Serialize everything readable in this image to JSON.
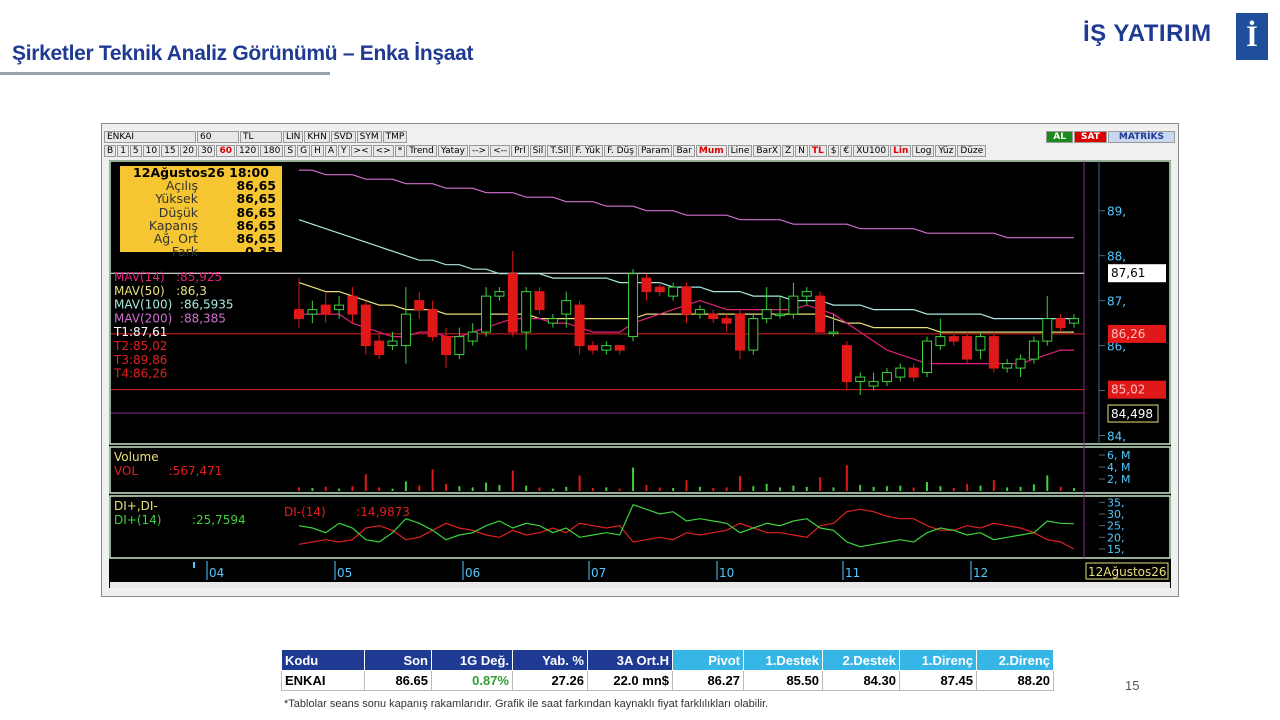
{
  "header": {
    "title": "Şirketler Teknik Analiz Görünümü – Enka İnşaat",
    "logo_text": "İŞ YATIRIM",
    "logo_mark": "İ",
    "page_number": "15"
  },
  "toolbar": {
    "row1": [
      "ENKAI",
      "60",
      "TL",
      "LIN",
      "KHN",
      "SVD",
      "SYM",
      "TMP"
    ],
    "al_label": "AL",
    "sat_label": "SAT",
    "brand": "MATRİKS",
    "row2": [
      "B",
      "1",
      "5",
      "10",
      "15",
      "20",
      "30",
      "60",
      "120",
      "180",
      "S",
      "G",
      "H",
      "A",
      "Y",
      "><",
      "<>",
      "*",
      "Trend",
      "Yatay",
      "-->",
      "<--",
      "Prl",
      "Sil",
      "T.Sil",
      "F. Yük",
      "F. Düş",
      "Param",
      "Bar",
      "Mum",
      "Line",
      "BarX",
      "Z",
      "N",
      "TL",
      "$",
      "€",
      "XU100",
      "Lin",
      "Log",
      "Yüz",
      "Düze"
    ]
  },
  "info_box": {
    "date": "12Ağustos26 18:00",
    "rows": [
      {
        "label": "Açılış",
        "value": "86,65"
      },
      {
        "label": "Yüksek",
        "value": "86,65"
      },
      {
        "label": "Düşük",
        "value": "86,65"
      },
      {
        "label": "Kapanış",
        "value": "86,65"
      },
      {
        "label": "Ağ. Ort",
        "value": "86,65"
      },
      {
        "label": "Fark",
        "value": "0,35"
      }
    ]
  },
  "legend": {
    "mav14": "MAV(14)   :85,925",
    "mav50": "MAV(50)   :86,3",
    "mav100": "MAV(100)  :86,5935",
    "mav200": "MAV(200)  :88,385",
    "t1": "T1:87,61",
    "t2": "T2:85,02",
    "t3": "T3:89,86",
    "t4": "T4:86,26"
  },
  "price_axis": {
    "ticks": [
      "89,",
      "88,",
      "87,",
      "86,",
      "85,",
      "84,"
    ],
    "labels": {
      "t1": "87,61",
      "t4": "86,26",
      "t2": "85,02",
      "low": "84,498"
    }
  },
  "volume_panel": {
    "title": "Volume",
    "vol": "VOL        :567,471",
    "ticks": [
      "6, M",
      "4, M",
      "2, M"
    ]
  },
  "di_panel": {
    "title": "DI+,DI-",
    "di_plus": "DI+(14)        :25,7594",
    "di_minus": "DI-(14)        :14,9873",
    "ticks": [
      "35,",
      "30,",
      "25,",
      "20,",
      "15,"
    ]
  },
  "time_axis": {
    "labels": [
      "04",
      "05",
      "06",
      "07",
      "10",
      "11",
      "12"
    ],
    "current": "12Ağustos26"
  },
  "colors": {
    "up": "#3cd23c",
    "down": "#e01818",
    "mav14": "#e0207a",
    "mav50": "#e8e07a",
    "mav100": "#a8e8e0",
    "mav200": "#d070d0"
  },
  "table": {
    "headers": [
      "Kodu",
      "Son",
      "1G Değ.",
      "Yab. %",
      "3A Ort.H",
      "Pivot",
      "1.Destek",
      "2.Destek",
      "1.Direnç",
      "2.Direnç"
    ],
    "row": [
      "ENKAI",
      "86.65",
      "0.87%",
      "27.26",
      "22.0 mn$",
      "86.27",
      "85.50",
      "84.30",
      "87.45",
      "88.20"
    ]
  },
  "footnote": "*Tablolar seans sonu kapanış rakamlarıdır. Grafik ile saat farkından kaynaklı fiyat farklılıkları olabilir.",
  "chart_data": {
    "type": "candlestick",
    "unit": "TRY",
    "candles": [
      {
        "o": 86.8,
        "c": 86.6,
        "h": 87.5,
        "l": 86.4
      },
      {
        "o": 86.7,
        "c": 86.8,
        "h": 87.0,
        "l": 86.5
      },
      {
        "o": 86.9,
        "c": 86.7,
        "h": 87.2,
        "l": 86.5
      },
      {
        "o": 86.8,
        "c": 86.9,
        "h": 87.1,
        "l": 86.6
      },
      {
        "o": 87.1,
        "c": 86.7,
        "h": 87.3,
        "l": 86.5
      },
      {
        "o": 86.9,
        "c": 86.0,
        "h": 87.0,
        "l": 85.8
      },
      {
        "o": 86.1,
        "c": 85.8,
        "h": 86.3,
        "l": 85.7
      },
      {
        "o": 86.0,
        "c": 86.1,
        "h": 86.3,
        "l": 85.9
      },
      {
        "o": 86.0,
        "c": 86.7,
        "h": 87.3,
        "l": 85.6
      },
      {
        "o": 87.0,
        "c": 86.8,
        "h": 87.2,
        "l": 86.6
      },
      {
        "o": 86.8,
        "c": 86.2,
        "h": 87.0,
        "l": 86.1
      },
      {
        "o": 86.2,
        "c": 85.8,
        "h": 86.4,
        "l": 85.5
      },
      {
        "o": 85.8,
        "c": 86.2,
        "h": 86.4,
        "l": 85.7
      },
      {
        "o": 86.1,
        "c": 86.3,
        "h": 86.5,
        "l": 86.0
      },
      {
        "o": 86.3,
        "c": 87.1,
        "h": 87.3,
        "l": 86.2
      },
      {
        "o": 87.1,
        "c": 87.2,
        "h": 87.3,
        "l": 87.0
      },
      {
        "o": 87.6,
        "c": 86.3,
        "h": 88.1,
        "l": 86.2
      },
      {
        "o": 86.3,
        "c": 87.2,
        "h": 87.3,
        "l": 85.9
      },
      {
        "o": 87.2,
        "c": 86.8,
        "h": 87.3,
        "l": 86.7
      },
      {
        "o": 86.5,
        "c": 86.6,
        "h": 86.7,
        "l": 86.4
      },
      {
        "o": 86.7,
        "c": 87.0,
        "h": 87.2,
        "l": 86.4
      },
      {
        "o": 86.9,
        "c": 86.0,
        "h": 87.0,
        "l": 85.8
      },
      {
        "o": 86.0,
        "c": 85.9,
        "h": 86.1,
        "l": 85.8
      },
      {
        "o": 85.9,
        "c": 86.0,
        "h": 86.1,
        "l": 85.8
      },
      {
        "o": 86.0,
        "c": 85.9,
        "h": 86.0,
        "l": 85.8
      },
      {
        "o": 86.2,
        "c": 87.6,
        "h": 87.7,
        "l": 86.1
      },
      {
        "o": 87.5,
        "c": 87.2,
        "h": 87.6,
        "l": 87.0
      },
      {
        "o": 87.3,
        "c": 87.2,
        "h": 87.4,
        "l": 87.1
      },
      {
        "o": 87.1,
        "c": 87.3,
        "h": 87.4,
        "l": 87.0
      },
      {
        "o": 87.3,
        "c": 86.7,
        "h": 87.4,
        "l": 86.5
      },
      {
        "o": 86.7,
        "c": 86.8,
        "h": 86.9,
        "l": 86.6
      },
      {
        "o": 86.7,
        "c": 86.6,
        "h": 86.8,
        "l": 86.5
      },
      {
        "o": 86.6,
        "c": 86.5,
        "h": 86.7,
        "l": 86.3
      },
      {
        "o": 86.7,
        "c": 85.9,
        "h": 86.8,
        "l": 85.7
      },
      {
        "o": 85.9,
        "c": 86.6,
        "h": 86.7,
        "l": 85.8
      },
      {
        "o": 86.6,
        "c": 86.8,
        "h": 87.3,
        "l": 86.5
      },
      {
        "o": 86.7,
        "c": 86.7,
        "h": 87.1,
        "l": 86.6
      },
      {
        "o": 86.7,
        "c": 87.1,
        "h": 87.4,
        "l": 86.6
      },
      {
        "o": 87.1,
        "c": 87.2,
        "h": 87.3,
        "l": 86.9
      },
      {
        "o": 87.1,
        "c": 86.3,
        "h": 87.2,
        "l": 86.3
      },
      {
        "o": 86.3,
        "c": 86.3,
        "h": 86.7,
        "l": 86.2
      },
      {
        "o": 86.0,
        "c": 85.2,
        "h": 86.1,
        "l": 85.0
      },
      {
        "o": 85.2,
        "c": 85.3,
        "h": 85.4,
        "l": 84.9
      },
      {
        "o": 85.1,
        "c": 85.2,
        "h": 85.4,
        "l": 85.0
      },
      {
        "o": 85.2,
        "c": 85.4,
        "h": 85.5,
        "l": 85.1
      },
      {
        "o": 85.3,
        "c": 85.5,
        "h": 85.6,
        "l": 85.2
      },
      {
        "o": 85.5,
        "c": 85.3,
        "h": 85.6,
        "l": 85.2
      },
      {
        "o": 85.4,
        "c": 86.1,
        "h": 86.2,
        "l": 85.3
      },
      {
        "o": 86.0,
        "c": 86.2,
        "h": 86.6,
        "l": 85.9
      },
      {
        "o": 86.2,
        "c": 86.1,
        "h": 86.3,
        "l": 86.0
      },
      {
        "o": 86.2,
        "c": 85.7,
        "h": 86.3,
        "l": 85.6
      },
      {
        "o": 85.9,
        "c": 86.2,
        "h": 86.3,
        "l": 85.7
      },
      {
        "o": 86.2,
        "c": 85.5,
        "h": 86.3,
        "l": 85.4
      },
      {
        "o": 85.5,
        "c": 85.6,
        "h": 85.7,
        "l": 85.4
      },
      {
        "o": 85.5,
        "c": 85.7,
        "h": 85.8,
        "l": 85.3
      },
      {
        "o": 85.7,
        "c": 86.1,
        "h": 86.2,
        "l": 85.6
      },
      {
        "o": 86.1,
        "c": 86.6,
        "h": 87.1,
        "l": 86.0
      },
      {
        "o": 86.6,
        "c": 86.4,
        "h": 86.7,
        "l": 86.3
      },
      {
        "o": 86.5,
        "c": 86.6,
        "h": 86.7,
        "l": 86.4
      }
    ],
    "mav14": [
      86.7,
      86.7,
      86.7,
      86.7,
      86.5,
      86.4,
      86.3,
      86.2,
      86.2,
      86.3,
      86.3,
      86.2,
      86.2,
      86.3,
      86.4,
      86.5,
      86.6,
      86.6,
      86.6,
      86.5,
      86.5,
      86.4,
      86.3,
      86.3,
      86.3,
      86.5,
      86.6,
      86.7,
      86.8,
      86.9,
      87.0,
      86.9,
      86.8,
      86.8,
      86.8,
      86.8,
      86.8,
      86.8,
      86.9,
      86.8,
      86.7,
      86.5,
      86.3,
      86.1,
      85.9,
      85.8,
      85.7,
      85.6,
      85.6,
      85.6,
      85.6,
      85.6,
      85.6,
      85.6,
      85.6,
      85.7,
      85.8,
      85.9,
      85.9
    ],
    "mav50": [
      87.4,
      87.3,
      87.2,
      87.2,
      87.1,
      87.0,
      86.9,
      86.9,
      86.8,
      86.8,
      86.8,
      86.7,
      86.7,
      86.7,
      86.7,
      86.7,
      86.7,
      86.7,
      86.6,
      86.6,
      86.6,
      86.6,
      86.6,
      86.6,
      86.6,
      86.6,
      86.7,
      86.7,
      86.7,
      86.7,
      86.7,
      86.7,
      86.7,
      86.7,
      86.7,
      86.7,
      86.7,
      86.7,
      86.7,
      86.7,
      86.6,
      86.5,
      86.5,
      86.4,
      86.4,
      86.4,
      86.4,
      86.4,
      86.3,
      86.3,
      86.3,
      86.3,
      86.3,
      86.3,
      86.3,
      86.3,
      86.3,
      86.3,
      86.3
    ],
    "mav100": [
      88.8,
      88.7,
      88.6,
      88.5,
      88.4,
      88.3,
      88.2,
      88.1,
      88.0,
      87.9,
      87.9,
      87.8,
      87.8,
      87.7,
      87.7,
      87.6,
      87.6,
      87.6,
      87.6,
      87.5,
      87.5,
      87.5,
      87.5,
      87.5,
      87.4,
      87.4,
      87.4,
      87.4,
      87.3,
      87.3,
      87.3,
      87.2,
      87.2,
      87.2,
      87.1,
      87.1,
      87.1,
      87.0,
      87.0,
      87.0,
      86.9,
      86.9,
      86.9,
      86.8,
      86.8,
      86.8,
      86.8,
      86.7,
      86.7,
      86.7,
      86.7,
      86.7,
      86.6,
      86.6,
      86.6,
      86.6,
      86.6,
      86.6,
      86.6
    ],
    "mav200": [
      89.9,
      89.9,
      89.8,
      89.8,
      89.8,
      89.7,
      89.7,
      89.7,
      89.6,
      89.6,
      89.6,
      89.5,
      89.5,
      89.5,
      89.4,
      89.4,
      89.4,
      89.3,
      89.3,
      89.3,
      89.2,
      89.2,
      89.2,
      89.1,
      89.1,
      89.1,
      89.0,
      89.0,
      89.0,
      88.9,
      88.9,
      88.9,
      88.9,
      88.8,
      88.8,
      88.8,
      88.8,
      88.7,
      88.7,
      88.7,
      88.7,
      88.7,
      88.6,
      88.6,
      88.6,
      88.6,
      88.6,
      88.5,
      88.5,
      88.5,
      88.5,
      88.5,
      88.5,
      88.4,
      88.4,
      88.4,
      88.4,
      88.4,
      88.4
    ],
    "volume_m": [
      0.6,
      0.5,
      0.7,
      0.4,
      0.8,
      2.8,
      0.6,
      0.4,
      1.6,
      0.9,
      3.6,
      1.2,
      0.8,
      0.6,
      1.4,
      1.0,
      3.4,
      0.9,
      0.6,
      0.4,
      0.7,
      2.6,
      0.5,
      0.6,
      0.4,
      3.9,
      1.0,
      0.6,
      0.5,
      1.8,
      0.7,
      0.5,
      0.6,
      2.5,
      0.8,
      1.2,
      0.6,
      0.9,
      0.7,
      2.3,
      0.6,
      4.3,
      1.0,
      0.7,
      0.8,
      0.9,
      0.6,
      1.5,
      0.8,
      0.5,
      1.2,
      0.9,
      1.8,
      0.6,
      0.7,
      1.1,
      2.6,
      0.7,
      0.5
    ],
    "di_plus": [
      25,
      24,
      22,
      26,
      24,
      19,
      18,
      22,
      28,
      26,
      23,
      19,
      21,
      22,
      25,
      27,
      24,
      26,
      25,
      22,
      24,
      20,
      21,
      22,
      21,
      34,
      32,
      30,
      31,
      27,
      28,
      27,
      26,
      22,
      24,
      26,
      25,
      27,
      28,
      24,
      23,
      18,
      16,
      17,
      18,
      19,
      18,
      22,
      24,
      23,
      21,
      22,
      19,
      20,
      21,
      22,
      27,
      26,
      25.8
    ],
    "di_minus": [
      17,
      18,
      19,
      18,
      19,
      24,
      25,
      23,
      19,
      20,
      23,
      26,
      24,
      23,
      21,
      20,
      23,
      21,
      22,
      24,
      22,
      26,
      25,
      24,
      25,
      18,
      19,
      20,
      19,
      22,
      21,
      22,
      23,
      26,
      24,
      22,
      22,
      21,
      20,
      25,
      26,
      31,
      32,
      31,
      29,
      28,
      28,
      25,
      23,
      23,
      25,
      24,
      26,
      25,
      24,
      22,
      19,
      18,
      15
    ]
  }
}
